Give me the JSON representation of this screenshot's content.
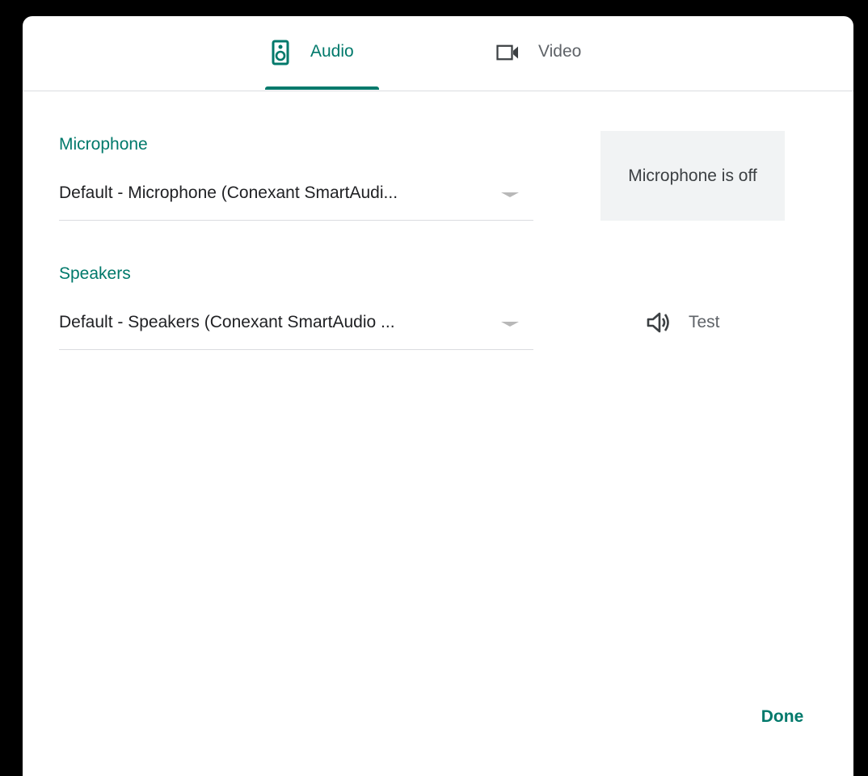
{
  "tabs": {
    "audio": {
      "label": "Audio",
      "icon": "speaker-icon",
      "active": true
    },
    "video": {
      "label": "Video",
      "icon": "videocam-icon",
      "active": false
    }
  },
  "microphone": {
    "label": "Microphone",
    "selected": "Default - Microphone (Conexant SmartAudi...",
    "status": "Microphone is off"
  },
  "speakers": {
    "label": "Speakers",
    "selected": "Default - Speakers (Conexant SmartAudio ...",
    "test_label": "Test",
    "test_icon": "volume-icon"
  },
  "footer": {
    "done_label": "Done"
  },
  "colors": {
    "accent": "#00796b",
    "text": "#202124",
    "muted": "#5f6368",
    "divider": "#dadce0",
    "status_bg": "#f1f3f4"
  }
}
